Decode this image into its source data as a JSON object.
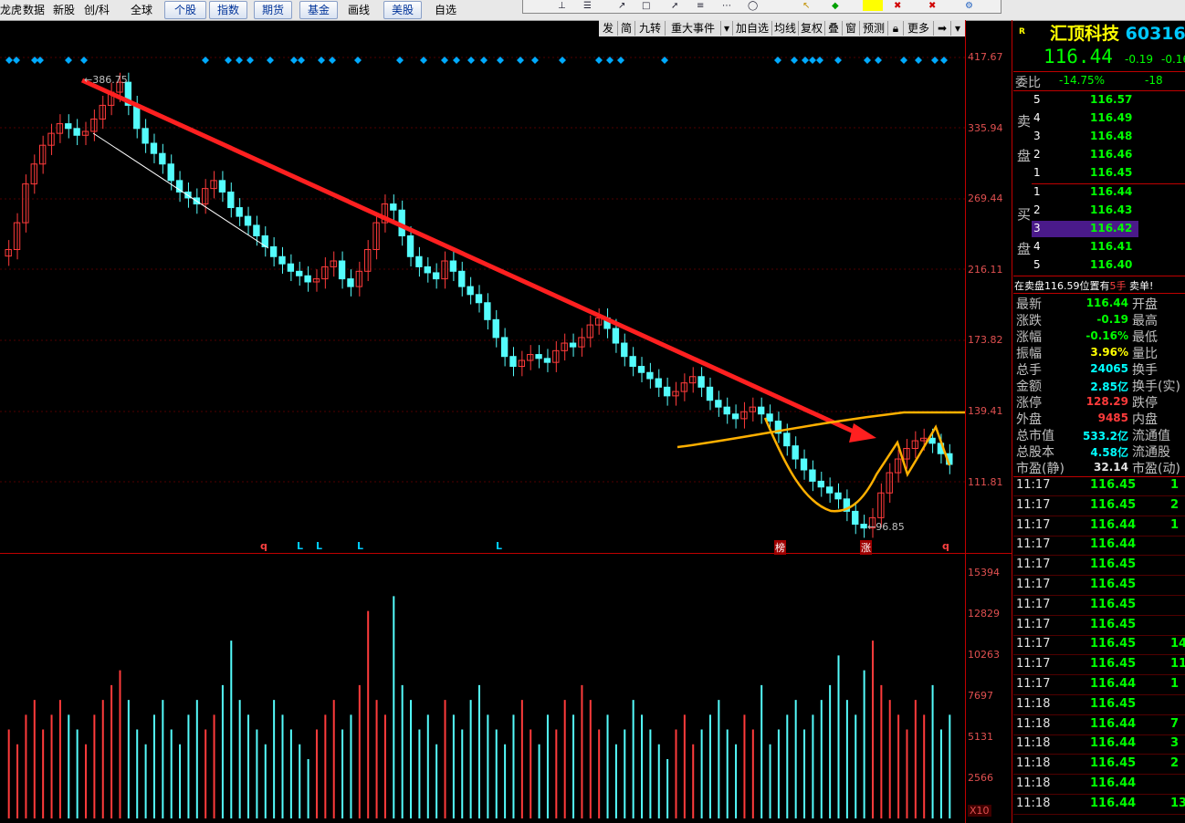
{
  "menu": {
    "items": [
      "龙虎",
      "数据",
      "新股",
      "创/科",
      "全球"
    ],
    "buttons": [
      "个股",
      "指数",
      "期货",
      "基金"
    ],
    "items2": [
      "画线"
    ],
    "buttons2": [
      "美股"
    ],
    "items3": [
      "自选"
    ]
  },
  "chart_toolbar": [
    "发",
    "简",
    "九转",
    "重大事件",
    "加自选",
    "均线",
    "复权",
    "叠",
    "窗",
    "预测",
    "更多"
  ],
  "price_axis": [
    "417.67",
    "335.94",
    "269.44",
    "216.11",
    "173.82",
    "139.41",
    "111.81"
  ],
  "volume_axis": [
    "15394",
    "12829",
    "10263",
    "7697",
    "5131",
    "2566"
  ],
  "volume_multiplier": "X10",
  "annotations": {
    "high_label": "386.75",
    "low_label": "96.85"
  },
  "markers": {
    "q1": "q",
    "l1": "L",
    "l2": "L",
    "l3": "L",
    "l4": "L",
    "bang": "榜",
    "zhang": "涨",
    "q2": "q"
  },
  "stock": {
    "r_label": "R",
    "name": "汇顶科技",
    "code": "60316",
    "price": "116.44",
    "change": "-0.19",
    "change_pct": "-0.16"
  },
  "weibi": {
    "label": "委比",
    "pct": "-14.75%",
    "diff": "-18"
  },
  "sell": {
    "label_1": "卖",
    "label_2": "盘",
    "levels": [
      {
        "n": "5",
        "p": "116.57"
      },
      {
        "n": "4",
        "p": "116.49"
      },
      {
        "n": "3",
        "p": "116.48"
      },
      {
        "n": "2",
        "p": "116.46"
      },
      {
        "n": "1",
        "p": "116.45"
      }
    ]
  },
  "buy": {
    "label_1": "买",
    "label_2": "盘",
    "levels": [
      {
        "n": "1",
        "p": "116.44"
      },
      {
        "n": "2",
        "p": "116.43"
      },
      {
        "n": "3",
        "p": "116.42"
      },
      {
        "n": "4",
        "p": "116.41"
      },
      {
        "n": "5",
        "p": "116.40"
      }
    ]
  },
  "notice": {
    "text": "在卖盘116.59位置有",
    "qty": "5手",
    "action": "卖单!"
  },
  "stats": [
    {
      "l": "最新",
      "v": "116.44",
      "r": "开盘",
      "vc": "green"
    },
    {
      "l": "涨跌",
      "v": "-0.19",
      "r": "最高",
      "vc": "green"
    },
    {
      "l": "涨幅",
      "v": "-0.16%",
      "r": "最低",
      "vc": "green"
    },
    {
      "l": "振幅",
      "v": "3.96%",
      "r": "量比",
      "vc": "yellow"
    },
    {
      "l": "总手",
      "v": "24065",
      "r": "换手",
      "vc": "cyan"
    },
    {
      "l": "金额",
      "v": "2.85亿",
      "r": "换手(实)",
      "vc": "cyan"
    },
    {
      "l": "涨停",
      "v": "128.29",
      "r": "跌停",
      "vc": "red"
    },
    {
      "l": "外盘",
      "v": "9485",
      "r": "内盘",
      "vc": "red"
    },
    {
      "l": "总市值",
      "v": "533.2亿",
      "r": "流通值",
      "vc": "cyan"
    },
    {
      "l": "总股本",
      "v": "4.58亿",
      "r": "流通股",
      "vc": "cyan"
    },
    {
      "l": "市盈(静)",
      "v": "32.14",
      "r": "市盈(动)",
      "vc": "white"
    }
  ],
  "ticks": [
    {
      "t": "11:17",
      "p": "116.45",
      "v": "1"
    },
    {
      "t": "11:17",
      "p": "116.45",
      "v": "2"
    },
    {
      "t": "11:17",
      "p": "116.44",
      "v": "1"
    },
    {
      "t": "11:17",
      "p": "116.44",
      "v": ""
    },
    {
      "t": "11:17",
      "p": "116.45",
      "v": ""
    },
    {
      "t": "11:17",
      "p": "116.45",
      "v": ""
    },
    {
      "t": "11:17",
      "p": "116.45",
      "v": ""
    },
    {
      "t": "11:17",
      "p": "116.45",
      "v": ""
    },
    {
      "t": "11:17",
      "p": "116.45",
      "v": "14"
    },
    {
      "t": "11:17",
      "p": "116.45",
      "v": "11"
    },
    {
      "t": "11:17",
      "p": "116.44",
      "v": "1"
    },
    {
      "t": "11:18",
      "p": "116.45",
      "v": ""
    },
    {
      "t": "11:18",
      "p": "116.44",
      "v": "7"
    },
    {
      "t": "11:18",
      "p": "116.44",
      "v": "3"
    },
    {
      "t": "11:18",
      "p": "116.45",
      "v": "2"
    },
    {
      "t": "11:18",
      "p": "116.44",
      "v": ""
    },
    {
      "t": "11:18",
      "p": "116.44",
      "v": "13"
    }
  ],
  "chart_data": {
    "type": "candlestick",
    "price_labels": {
      "high": 386.75,
      "low": 96.85
    },
    "price_ticks": [
      417.67,
      335.94,
      269.44,
      216.11,
      173.82,
      139.41,
      111.81
    ],
    "volume_ticks": [
      15394,
      12829,
      10263,
      7697,
      5131,
      2566
    ],
    "candles_close": [
      230,
      250,
      282,
      300,
      318,
      330,
      340,
      335,
      328,
      332,
      345,
      360,
      375,
      386.75,
      360,
      335,
      320,
      310,
      300,
      285,
      275,
      270,
      265,
      278,
      285,
      275,
      262,
      255,
      248,
      240,
      232,
      225,
      220,
      215,
      212,
      208,
      210,
      218,
      222,
      210,
      205,
      215,
      230,
      250,
      265,
      260,
      240,
      225,
      218,
      214,
      210,
      222,
      215,
      205,
      200,
      195,
      185,
      175,
      165,
      160,
      163,
      166,
      164,
      162,
      168,
      172,
      170,
      175,
      182,
      186,
      180,
      172,
      165,
      160,
      157,
      154,
      150,
      146,
      148,
      152,
      155,
      150,
      144,
      141,
      138,
      136,
      139,
      141,
      138,
      135,
      130,
      125,
      120,
      116,
      112,
      110,
      108,
      106,
      102,
      98,
      96.85,
      100,
      108,
      115,
      120,
      124,
      127,
      128,
      126,
      122,
      118
    ],
    "volumes": [
      6,
      5,
      7,
      8,
      6,
      7,
      8,
      7,
      6,
      5,
      7,
      8,
      9,
      10,
      8,
      6,
      5,
      7,
      8,
      6,
      5,
      7,
      8,
      6,
      7,
      9,
      12,
      8,
      7,
      6,
      5,
      8,
      7,
      6,
      5,
      4,
      6,
      7,
      8,
      6,
      7,
      9,
      14,
      8,
      7,
      15,
      9,
      8,
      6,
      7,
      5,
      8,
      7,
      6,
      8,
      9,
      7,
      6,
      5,
      7,
      8,
      6,
      5,
      7,
      6,
      8,
      7,
      9,
      8,
      6,
      7,
      5,
      6,
      8,
      7,
      6,
      5,
      4,
      6,
      7,
      5,
      6,
      7,
      8,
      6,
      5,
      7,
      6,
      9,
      5,
      6,
      7,
      8,
      6,
      7,
      8,
      9,
      11,
      8,
      7,
      10,
      12,
      9,
      8,
      7,
      6,
      8,
      7,
      9,
      6,
      7
    ]
  }
}
